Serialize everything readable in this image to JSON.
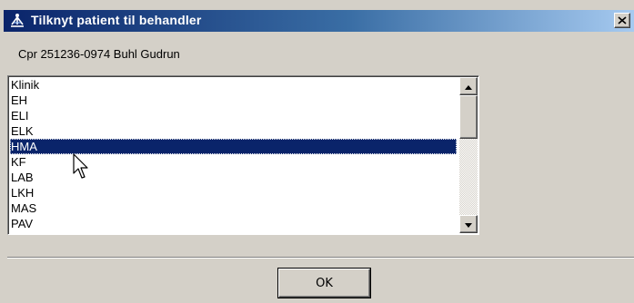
{
  "window": {
    "title": "Tilknyt patient til behandler",
    "app_icon": "app-logo-icon",
    "close_icon": "close-icon",
    "colors": {
      "title_bar_start": "#0a246a",
      "title_bar_end": "#a6caf0",
      "face": "#d4d0c8",
      "selection": "#0a246a"
    }
  },
  "patient": {
    "cpr_label": "Cpr 251236-0974 Buhl Gudrun"
  },
  "list": {
    "items": [
      "Klinik",
      "EH",
      "ELI",
      "ELK",
      "HMA",
      "KF",
      "LAB",
      "LKH",
      "MAS",
      "PAV"
    ],
    "selected": "HMA",
    "scroll_up_icon": "scroll-up-arrow-icon",
    "scroll_down_icon": "scroll-down-arrow-icon"
  },
  "footer": {
    "ok_label": "OK"
  },
  "cursor": {
    "icon": "mouse-pointer-icon"
  }
}
